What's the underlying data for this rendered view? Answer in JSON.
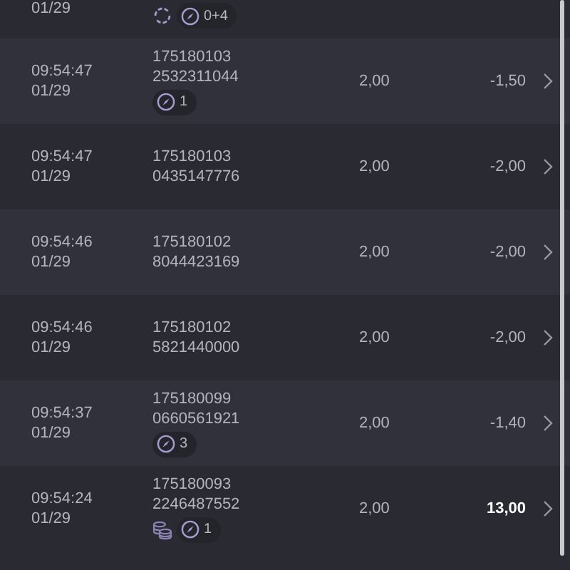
{
  "partial_row": {
    "date": "01/29",
    "tags": [
      {
        "kind": "refresh"
      },
      {
        "kind": "count",
        "text": "0+4"
      }
    ]
  },
  "rows": [
    {
      "time": "09:54:47",
      "date": "01/29",
      "ids": [
        "175180103",
        "2532311044"
      ],
      "tags": [
        {
          "kind": "count",
          "text": "1"
        }
      ],
      "stake": "2,00",
      "result": "-1,50",
      "highlight": false
    },
    {
      "time": "09:54:47",
      "date": "01/29",
      "ids": [
        "175180103",
        "0435147776"
      ],
      "tags": [],
      "stake": "2,00",
      "result": "-2,00",
      "highlight": false
    },
    {
      "time": "09:54:46",
      "date": "01/29",
      "ids": [
        "175180102",
        "8044423169"
      ],
      "tags": [],
      "stake": "2,00",
      "result": "-2,00",
      "highlight": false
    },
    {
      "time": "09:54:46",
      "date": "01/29",
      "ids": [
        "175180102",
        "5821440000"
      ],
      "tags": [],
      "stake": "2,00",
      "result": "-2,00",
      "highlight": false
    },
    {
      "time": "09:54:37",
      "date": "01/29",
      "ids": [
        "175180099",
        "0660561921"
      ],
      "tags": [
        {
          "kind": "count",
          "text": "3"
        }
      ],
      "stake": "2,00",
      "result": "-1,40",
      "highlight": false
    },
    {
      "time": "09:54:24",
      "date": "01/29",
      "ids": [
        "175180093",
        "2246487552"
      ],
      "tags": [
        {
          "kind": "coins"
        },
        {
          "kind": "count",
          "text": "1"
        }
      ],
      "stake": "2,00",
      "result": "13,00",
      "highlight": true
    }
  ]
}
